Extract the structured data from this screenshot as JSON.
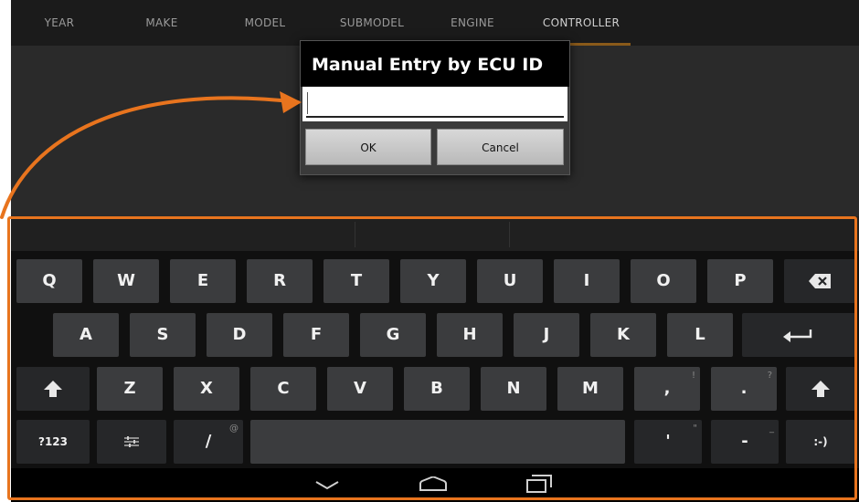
{
  "tabs": [
    {
      "label": "YEAR"
    },
    {
      "label": "MAKE"
    },
    {
      "label": "MODEL"
    },
    {
      "label": "SUBMODEL"
    },
    {
      "label": "ENGINE"
    },
    {
      "label": "CONTROLLER"
    }
  ],
  "active_tab": "CONTROLLER",
  "dialog": {
    "title": "Manual Entry by ECU ID",
    "input_value": "",
    "ok_label": "OK",
    "cancel_label": "Cancel"
  },
  "keyboard": {
    "row1": [
      "Q",
      "W",
      "E",
      "R",
      "T",
      "Y",
      "U",
      "I",
      "O",
      "P"
    ],
    "row2": [
      "A",
      "S",
      "D",
      "F",
      "G",
      "H",
      "J",
      "K",
      "L"
    ],
    "row3": [
      "Z",
      "X",
      "C",
      "V",
      "B",
      "N",
      "M"
    ],
    "comma": ",",
    "comma_hint": "!",
    "period": ".",
    "period_hint": "?",
    "num_label": "?123",
    "slash": "/",
    "slash_hint": "@",
    "apostrophe": "'",
    "apostrophe_hint": "\"",
    "dash": "-",
    "dash_hint": "_",
    "smiley": ":-)",
    "icons": [
      "backspace-icon",
      "enter-icon",
      "shift-icon",
      "settings-sliders-icon",
      "back-chevron-icon",
      "home-icon",
      "recents-icon"
    ]
  },
  "colors": {
    "highlight": "#e8741e",
    "keyboard_bg": "#101010",
    "key": "#3b3c3e"
  }
}
